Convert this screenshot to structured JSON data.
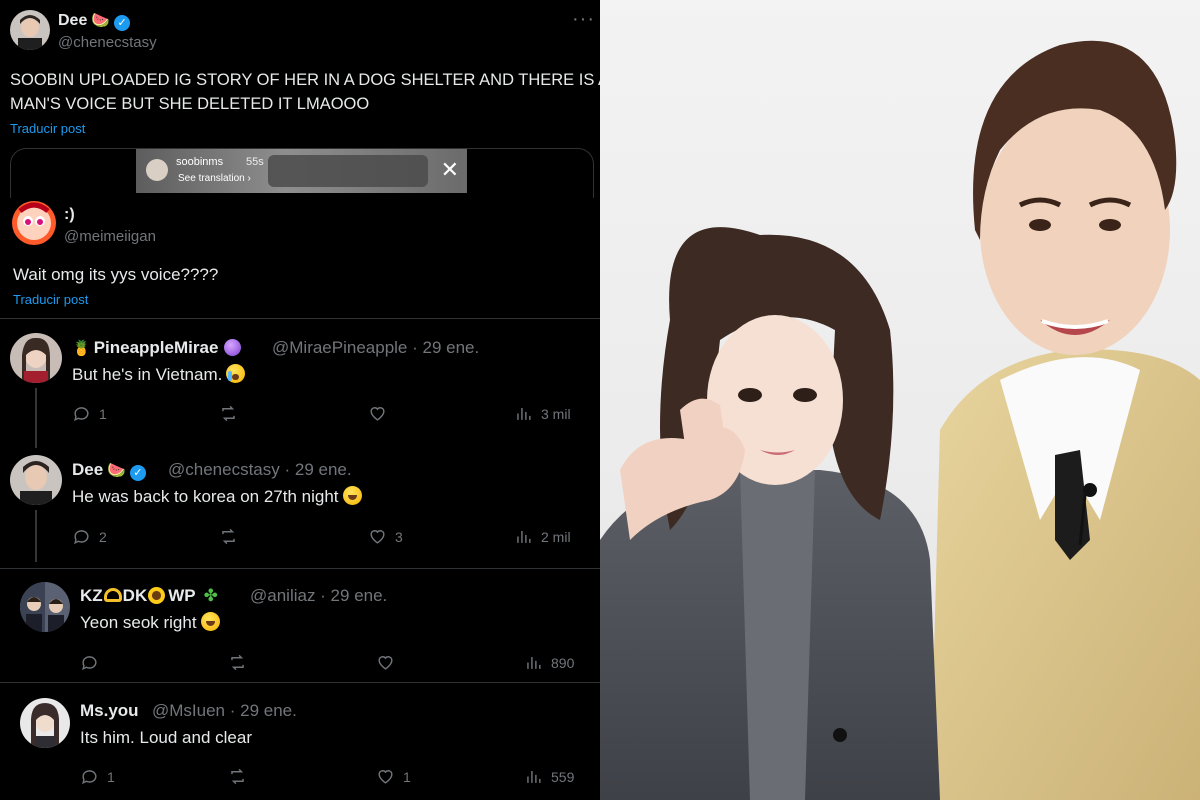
{
  "main_tweet": {
    "name": "Dee",
    "emoji": "🍉",
    "handle": "@chenecstasy",
    "text_line1": "SOOBIN UPLOADED IG STORY OF HER IN A DOG SHELTER AND THERE IS A",
    "text_line2": "MAN'S VOICE BUT SHE DELETED IT LMAOOO",
    "translate": "Traducir post",
    "more": "···"
  },
  "story": {
    "username": "soobinms",
    "time": "55s",
    "translation": "See translation ›",
    "close": "✕"
  },
  "quoted_tweet": {
    "name": ":)",
    "handle": "@meimeiigan",
    "text": "Wait omg its yys voice????",
    "translate": "Traducir post"
  },
  "replies": [
    {
      "name": "PineappleMirae",
      "prefix_emoji": "🍍",
      "handle": "@MiraePineapple · 29 ene.",
      "text": "But he's in Vietnam.",
      "replies": "1",
      "retweets": "",
      "likes": "",
      "views": "3 mil"
    },
    {
      "name": "Dee",
      "emoji": "🍉",
      "handle": "@chenecstasy · 29 ene.",
      "text": "He was back to korea on 27th night",
      "replies": "2",
      "retweets": "",
      "likes": "3",
      "views": "2 mil"
    },
    {
      "name": "KZ",
      "name_mid": "DK",
      "name_end": "WP",
      "handle": "@aniliaz · 29 ene.",
      "text": "Yeon seok right",
      "replies": "",
      "retweets": "",
      "likes": "",
      "views": "890"
    },
    {
      "name": "Ms.you",
      "handle": "@MsIuen · 29 ene.",
      "text": "Its him. Loud and clear",
      "replies": "1",
      "retweets": "",
      "likes": "1",
      "views": "559"
    }
  ],
  "colors": {
    "background": "#000000",
    "text": "#e7e9ea",
    "secondary": "#71767b",
    "link": "#1d9bf0",
    "verified": "#1d9bf0",
    "divider": "#2f3336"
  }
}
